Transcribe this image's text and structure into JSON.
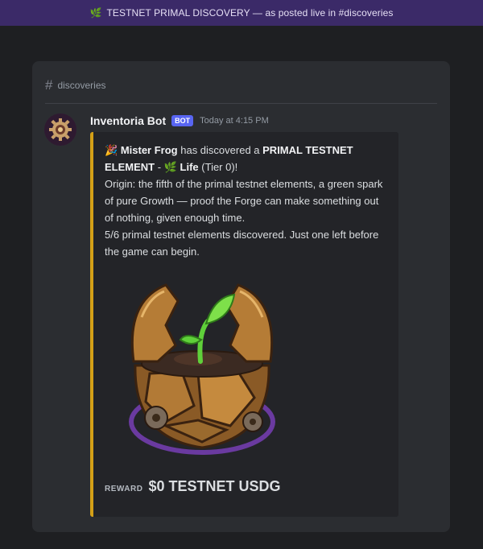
{
  "banner": {
    "icon": "leaf-icon",
    "text": "TESTNET PRIMAL DISCOVERY — as posted live in #discoveries"
  },
  "channel": {
    "name": "discoveries"
  },
  "message": {
    "author": "Inventoria Bot",
    "badge": "BOT",
    "timestamp": "Today at 4:15 PM",
    "embed": {
      "accent_color": "#d4a017",
      "line1": {
        "player": "Mister Frog",
        "verb": "has discovered a",
        "element_type": "PRIMAL TESTNET ELEMENT",
        "dash": "-",
        "element_name": "Life",
        "tier": "(Tier 0)!"
      },
      "origin": "Origin: the fifth of the primal testnet elements, a green spark of pure Growth — proof the Forge can make something out of nothing, given enough time.",
      "progress": "5/6 primal testnet elements discovered. Just one left before the game can begin.",
      "image_name": "life-element-art",
      "reward_label": "REWARD",
      "reward_value": "$0 TESTNET USDG"
    }
  }
}
